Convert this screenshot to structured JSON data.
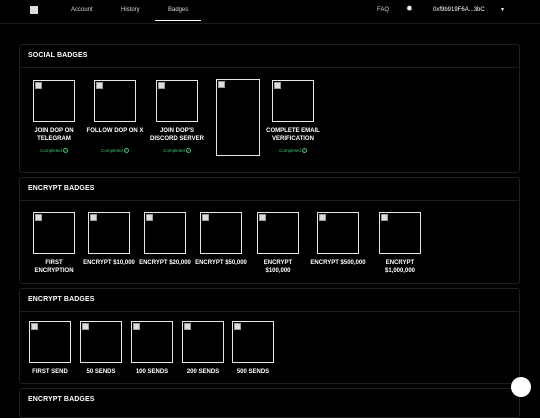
{
  "nav": {
    "items": [
      "Account",
      "History",
      "Badges"
    ],
    "active": "Badges",
    "faq": "FAQ",
    "wallet": "0xf9b919F6A...3bC",
    "icons": {
      "logo": "brand-logo",
      "settings": "gear-icon",
      "dropdown": "chevron-down-icon"
    }
  },
  "sections": {
    "social": {
      "title": "SOCIAL BADGES",
      "badges": [
        {
          "name": "JOIN DOP ON TELEGRAM",
          "status": "Completed"
        },
        {
          "name": "FOLLOW DOP ON X",
          "status": "Completed"
        },
        {
          "name": "JOIN DOP'S DISCORD SERVER",
          "status": "Completed"
        },
        {
          "name": "",
          "status": ""
        },
        {
          "name": "COMPLETE EMAIL VERIFICATION",
          "status": "Completed"
        }
      ]
    },
    "encrypt": {
      "title": "ENCRYPT BADGES",
      "badges": [
        {
          "name": "FIRST ENCRYPTION"
        },
        {
          "name": "ENCRYPT $10,000"
        },
        {
          "name": "ENCRYPT $20,000"
        },
        {
          "name": "ENCRYPT $50,000"
        },
        {
          "name": "ENCRYPT $100,000"
        },
        {
          "name": "ENCRYPT $500,000"
        },
        {
          "name": "ENCRYPT $1,000,000"
        }
      ]
    },
    "sends": {
      "title": "ENCRYPT BADGES",
      "badges": [
        {
          "name": "FIRST SEND"
        },
        {
          "name": "50 SENDS"
        },
        {
          "name": "100 SENDS"
        },
        {
          "name": "200 SENDS"
        },
        {
          "name": "500 SENDS"
        }
      ]
    },
    "fourth": {
      "title": "ENCRYPT BADGES"
    }
  },
  "colors": {
    "completed": "#3ec16a",
    "background": "#000000",
    "border": "#1f1f1f"
  }
}
